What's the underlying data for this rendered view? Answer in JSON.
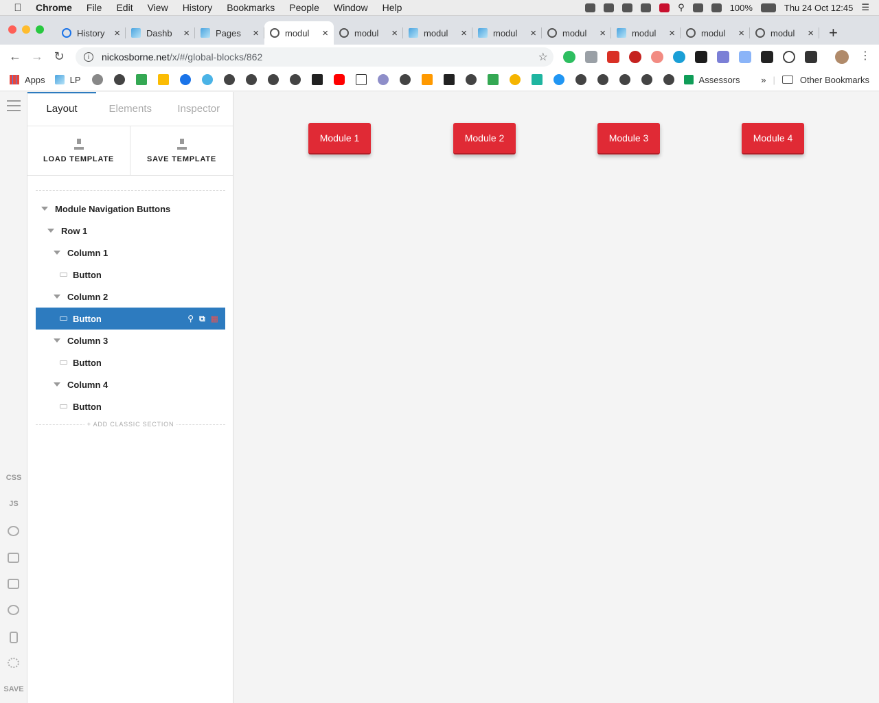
{
  "menubar": {
    "app": "Chrome",
    "items": [
      "File",
      "Edit",
      "View",
      "History",
      "Bookmarks",
      "People",
      "Window",
      "Help"
    ],
    "battery": "100%",
    "datetime": "Thu 24 Oct  12:45"
  },
  "tabs": [
    {
      "label": "History",
      "icon": "history-icon"
    },
    {
      "label": "Dashb",
      "icon": "site-icon"
    },
    {
      "label": "Pages",
      "icon": "site-icon"
    },
    {
      "label": "modul",
      "icon": "globe-icon",
      "active": true
    },
    {
      "label": "modul",
      "icon": "globe-icon"
    },
    {
      "label": "modul",
      "icon": "site-icon"
    },
    {
      "label": "modul",
      "icon": "site-icon"
    },
    {
      "label": "modul",
      "icon": "globe-icon"
    },
    {
      "label": "modul",
      "icon": "site-icon"
    },
    {
      "label": "modul",
      "icon": "globe-icon"
    },
    {
      "label": "modul",
      "icon": "globe-icon"
    }
  ],
  "url": {
    "host": "nickosborne.net",
    "path": "/x/#/global-blocks/862"
  },
  "bookmarks": {
    "apps": "Apps",
    "lp": "LP",
    "assessors": "Assessors",
    "other": "Other Bookmarks"
  },
  "rail": {
    "css": "CSS",
    "js": "JS",
    "save": "SAVE"
  },
  "panel": {
    "tabs": [
      "Layout",
      "Elements",
      "Inspector"
    ],
    "load_template": "LOAD TEMPLATE",
    "save_template": "SAVE TEMPLATE",
    "tree": {
      "root": "Module Navigation Buttons",
      "row": "Row 1",
      "col1": "Column 1",
      "btn1": "Button",
      "col2": "Column 2",
      "btn2": "Button",
      "col3": "Column 3",
      "btn3": "Button",
      "col4": "Column 4",
      "btn4": "Button"
    },
    "add_section": "+ ADD CLASSIC SECTION"
  },
  "canvas": {
    "buttons": [
      "Module 1",
      "Module 2",
      "Module 3",
      "Module 4"
    ],
    "button_color": "#e02a35"
  }
}
